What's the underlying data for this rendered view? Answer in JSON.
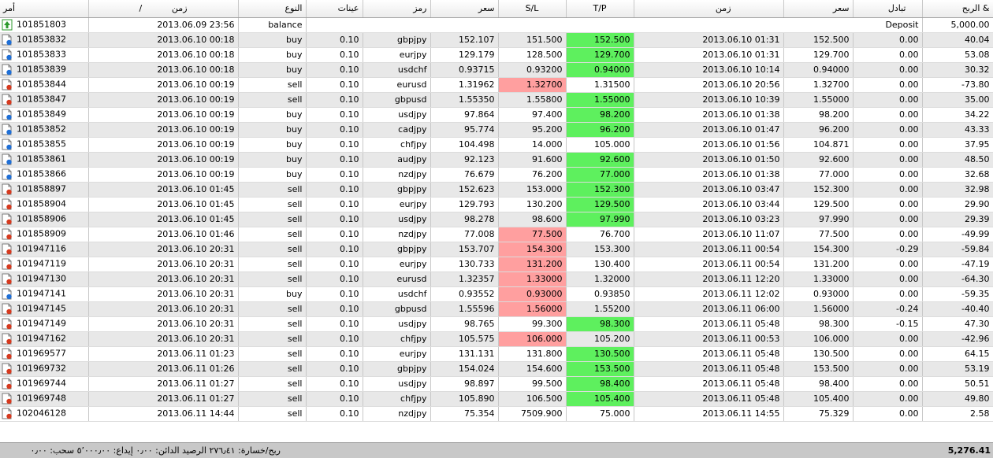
{
  "header": {
    "ticket": "أمر",
    "time": "زمن",
    "sort_mark": "/",
    "type": "النوع",
    "lots": "عينات",
    "symbol": "رمز",
    "open_price": "سعر",
    "sl": "S/L",
    "tp": "T/P",
    "close_time": "زمن",
    "close_price": "سعر",
    "swap": "تبادل",
    "profit": "الربح &"
  },
  "balance_row": {
    "ticket": "101851803",
    "time": "2013.06.09 23:56",
    "type": "balance",
    "comment": "Deposit",
    "profit": "5,000.00"
  },
  "rows": [
    {
      "ticket": "101853832",
      "time": "2013.06.10 00:18",
      "type": "buy",
      "lots": "0.10",
      "symbol": "gbpjpy",
      "open": "152.107",
      "sl": "151.500",
      "tp": "152.500",
      "close_time": "2013.06.10 01:31",
      "close": "152.500",
      "swap": "0.00",
      "profit": "40.04",
      "hit": "tp"
    },
    {
      "ticket": "101853833",
      "time": "2013.06.10 00:18",
      "type": "buy",
      "lots": "0.10",
      "symbol": "eurjpy",
      "open": "129.179",
      "sl": "128.500",
      "tp": "129.700",
      "close_time": "2013.06.10 01:31",
      "close": "129.700",
      "swap": "0.00",
      "profit": "53.08",
      "hit": "tp"
    },
    {
      "ticket": "101853839",
      "time": "2013.06.10 00:18",
      "type": "buy",
      "lots": "0.10",
      "symbol": "usdchf",
      "open": "0.93715",
      "sl": "0.93200",
      "tp": "0.94000",
      "close_time": "2013.06.10 10:14",
      "close": "0.94000",
      "swap": "0.00",
      "profit": "30.32",
      "hit": "tp"
    },
    {
      "ticket": "101853844",
      "time": "2013.06.10 00:19",
      "type": "sell",
      "lots": "0.10",
      "symbol": "eurusd",
      "open": "1.31962",
      "sl": "1.32700",
      "tp": "1.31500",
      "close_time": "2013.06.10 20:56",
      "close": "1.32700",
      "swap": "0.00",
      "profit": "-73.80",
      "hit": "sl"
    },
    {
      "ticket": "101853847",
      "time": "2013.06.10 00:19",
      "type": "sell",
      "lots": "0.10",
      "symbol": "gbpusd",
      "open": "1.55350",
      "sl": "1.55800",
      "tp": "1.55000",
      "close_time": "2013.06.10 10:39",
      "close": "1.55000",
      "swap": "0.00",
      "profit": "35.00",
      "hit": "tp"
    },
    {
      "ticket": "101853849",
      "time": "2013.06.10 00:19",
      "type": "buy",
      "lots": "0.10",
      "symbol": "usdjpy",
      "open": "97.864",
      "sl": "97.400",
      "tp": "98.200",
      "close_time": "2013.06.10 01:38",
      "close": "98.200",
      "swap": "0.00",
      "profit": "34.22",
      "hit": "tp"
    },
    {
      "ticket": "101853852",
      "time": "2013.06.10 00:19",
      "type": "buy",
      "lots": "0.10",
      "symbol": "cadjpy",
      "open": "95.774",
      "sl": "95.200",
      "tp": "96.200",
      "close_time": "2013.06.10 01:47",
      "close": "96.200",
      "swap": "0.00",
      "profit": "43.33",
      "hit": "tp"
    },
    {
      "ticket": "101853855",
      "time": "2013.06.10 00:19",
      "type": "buy",
      "lots": "0.10",
      "symbol": "chfjpy",
      "open": "104.498",
      "sl": "14.000",
      "tp": "105.000",
      "close_time": "2013.06.10 01:56",
      "close": "104.871",
      "swap": "0.00",
      "profit": "37.95",
      "hit": ""
    },
    {
      "ticket": "101853861",
      "time": "2013.06.10 00:19",
      "type": "buy",
      "lots": "0.10",
      "symbol": "audjpy",
      "open": "92.123",
      "sl": "91.600",
      "tp": "92.600",
      "close_time": "2013.06.10 01:50",
      "close": "92.600",
      "swap": "0.00",
      "profit": "48.50",
      "hit": "tp"
    },
    {
      "ticket": "101853866",
      "time": "2013.06.10 00:19",
      "type": "buy",
      "lots": "0.10",
      "symbol": "nzdjpy",
      "open": "76.679",
      "sl": "76.200",
      "tp": "77.000",
      "close_time": "2013.06.10 01:38",
      "close": "77.000",
      "swap": "0.00",
      "profit": "32.68",
      "hit": "tp"
    },
    {
      "ticket": "101858897",
      "time": "2013.06.10 01:45",
      "type": "sell",
      "lots": "0.10",
      "symbol": "gbpjpy",
      "open": "152.623",
      "sl": "153.000",
      "tp": "152.300",
      "close_time": "2013.06.10 03:47",
      "close": "152.300",
      "swap": "0.00",
      "profit": "32.98",
      "hit": "tp"
    },
    {
      "ticket": "101858904",
      "time": "2013.06.10 01:45",
      "type": "sell",
      "lots": "0.10",
      "symbol": "eurjpy",
      "open": "129.793",
      "sl": "130.200",
      "tp": "129.500",
      "close_time": "2013.06.10 03:44",
      "close": "129.500",
      "swap": "0.00",
      "profit": "29.90",
      "hit": "tp"
    },
    {
      "ticket": "101858906",
      "time": "2013.06.10 01:45",
      "type": "sell",
      "lots": "0.10",
      "symbol": "usdjpy",
      "open": "98.278",
      "sl": "98.600",
      "tp": "97.990",
      "close_time": "2013.06.10 03:23",
      "close": "97.990",
      "swap": "0.00",
      "profit": "29.39",
      "hit": "tp"
    },
    {
      "ticket": "101858909",
      "time": "2013.06.10 01:46",
      "type": "sell",
      "lots": "0.10",
      "symbol": "nzdjpy",
      "open": "77.008",
      "sl": "77.500",
      "tp": "76.700",
      "close_time": "2013.06.10 11:07",
      "close": "77.500",
      "swap": "0.00",
      "profit": "-49.99",
      "hit": "sl"
    },
    {
      "ticket": "101947116",
      "time": "2013.06.10 20:31",
      "type": "sell",
      "lots": "0.10",
      "symbol": "gbpjpy",
      "open": "153.707",
      "sl": "154.300",
      "tp": "153.300",
      "close_time": "2013.06.11 00:54",
      "close": "154.300",
      "swap": "-0.29",
      "profit": "-59.84",
      "hit": "sl"
    },
    {
      "ticket": "101947119",
      "time": "2013.06.10 20:31",
      "type": "sell",
      "lots": "0.10",
      "symbol": "eurjpy",
      "open": "130.733",
      "sl": "131.200",
      "tp": "130.400",
      "close_time": "2013.06.11 00:54",
      "close": "131.200",
      "swap": "0.00",
      "profit": "-47.19",
      "hit": "sl"
    },
    {
      "ticket": "101947130",
      "time": "2013.06.10 20:31",
      "type": "sell",
      "lots": "0.10",
      "symbol": "eurusd",
      "open": "1.32357",
      "sl": "1.33000",
      "tp": "1.32000",
      "close_time": "2013.06.11 12:20",
      "close": "1.33000",
      "swap": "0.00",
      "profit": "-64.30",
      "hit": "sl"
    },
    {
      "ticket": "101947141",
      "time": "2013.06.10 20:31",
      "type": "buy",
      "lots": "0.10",
      "symbol": "usdchf",
      "open": "0.93552",
      "sl": "0.93000",
      "tp": "0.93850",
      "close_time": "2013.06.11 12:02",
      "close": "0.93000",
      "swap": "0.00",
      "profit": "-59.35",
      "hit": "sl"
    },
    {
      "ticket": "101947145",
      "time": "2013.06.10 20:31",
      "type": "sell",
      "lots": "0.10",
      "symbol": "gbpusd",
      "open": "1.55596",
      "sl": "1.56000",
      "tp": "1.55200",
      "close_time": "2013.06.11 06:00",
      "close": "1.56000",
      "swap": "-0.24",
      "profit": "-40.40",
      "hit": "sl"
    },
    {
      "ticket": "101947149",
      "time": "2013.06.10 20:31",
      "type": "sell",
      "lots": "0.10",
      "symbol": "usdjpy",
      "open": "98.765",
      "sl": "99.300",
      "tp": "98.300",
      "close_time": "2013.06.11 05:48",
      "close": "98.300",
      "swap": "-0.15",
      "profit": "47.30",
      "hit": "tp"
    },
    {
      "ticket": "101947162",
      "time": "2013.06.10 20:31",
      "type": "sell",
      "lots": "0.10",
      "symbol": "chfjpy",
      "open": "105.575",
      "sl": "106.000",
      "tp": "105.200",
      "close_time": "2013.06.11 00:53",
      "close": "106.000",
      "swap": "0.00",
      "profit": "-42.96",
      "hit": "sl"
    },
    {
      "ticket": "101969577",
      "time": "2013.06.11 01:23",
      "type": "sell",
      "lots": "0.10",
      "symbol": "eurjpy",
      "open": "131.131",
      "sl": "131.800",
      "tp": "130.500",
      "close_time": "2013.06.11 05:48",
      "close": "130.500",
      "swap": "0.00",
      "profit": "64.15",
      "hit": "tp"
    },
    {
      "ticket": "101969732",
      "time": "2013.06.11 01:26",
      "type": "sell",
      "lots": "0.10",
      "symbol": "gbpjpy",
      "open": "154.024",
      "sl": "154.600",
      "tp": "153.500",
      "close_time": "2013.06.11 05:48",
      "close": "153.500",
      "swap": "0.00",
      "profit": "53.19",
      "hit": "tp"
    },
    {
      "ticket": "101969744",
      "time": "2013.06.11 01:27",
      "type": "sell",
      "lots": "0.10",
      "symbol": "usdjpy",
      "open": "98.897",
      "sl": "99.500",
      "tp": "98.400",
      "close_time": "2013.06.11 05:48",
      "close": "98.400",
      "swap": "0.00",
      "profit": "50.51",
      "hit": "tp"
    },
    {
      "ticket": "101969748",
      "time": "2013.06.11 01:27",
      "type": "sell",
      "lots": "0.10",
      "symbol": "chfjpy",
      "open": "105.890",
      "sl": "106.500",
      "tp": "105.400",
      "close_time": "2013.06.11 05:48",
      "close": "105.400",
      "swap": "0.00",
      "profit": "49.80",
      "hit": "tp"
    },
    {
      "ticket": "102046128",
      "time": "2013.06.11 14:44",
      "type": "sell",
      "lots": "0.10",
      "symbol": "nzdjpy",
      "open": "75.354",
      "sl": "7509.900",
      "tp": "75.000",
      "close_time": "2013.06.11 14:55",
      "close": "75.329",
      "swap": "0.00",
      "profit": "2.58",
      "hit": ""
    }
  ],
  "footer": {
    "summary": "ربح/خسارة: ٢٧٦٫٤١  الرصيد الدائن: ٠٫٠٠  إيداع: ٥٬٠٠٠٫٠٠  سحب: ٠٫٠٠",
    "total": "5,276.41"
  },
  "colors": {
    "tp_hit": "#5ef05e",
    "sl_hit": "#ff9f9f",
    "row_alt": "#e8e8e8",
    "footer_bg": "#c8c8c8",
    "buy_icon": "#1f6fd6",
    "sell_icon": "#d63a1f",
    "balance_icon": "#2e9a2e"
  },
  "icons": {
    "buy": "buy-order-icon",
    "sell": "sell-order-icon",
    "balance": "deposit-icon"
  }
}
